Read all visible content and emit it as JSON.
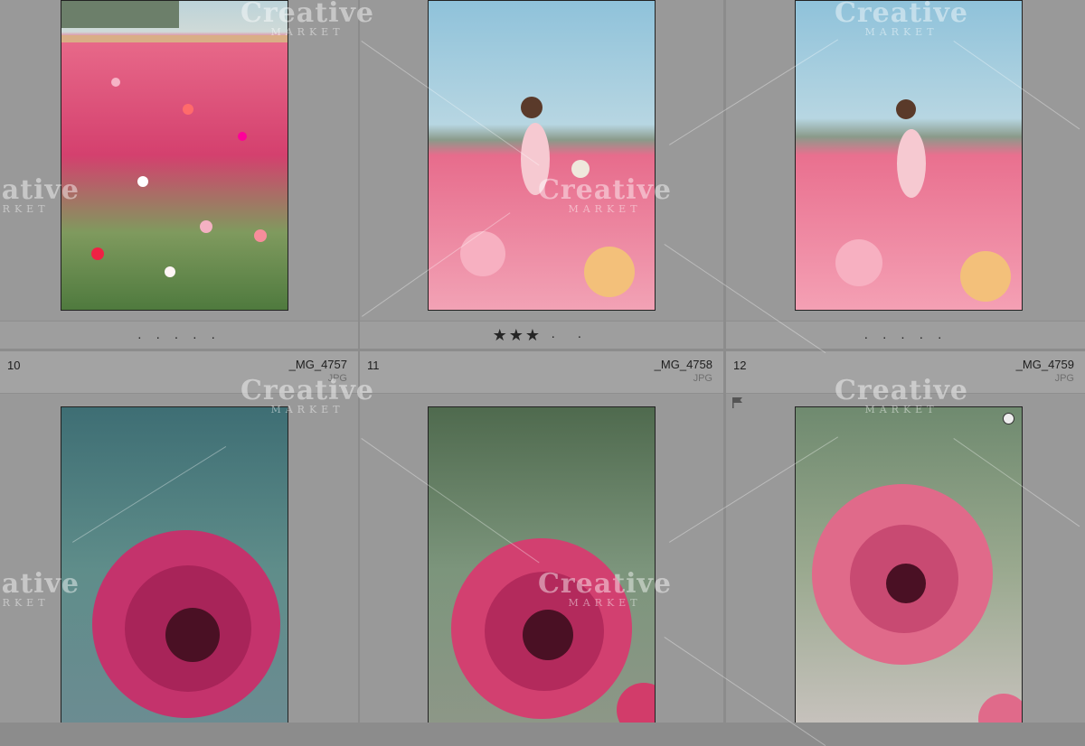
{
  "cells": [
    {
      "index": "",
      "filename": "",
      "ext": "",
      "rating_text": ". . . . ."
    },
    {
      "index": "",
      "filename": "",
      "ext": "",
      "stars": "★★★",
      "rating_dots": "· ·"
    },
    {
      "index": "",
      "filename": "",
      "ext": "",
      "rating_text": ". . . . ."
    },
    {
      "index": "10",
      "filename": "_MG_4757",
      "ext": "JPG"
    },
    {
      "index": "11",
      "filename": "_MG_4758",
      "ext": "JPG"
    },
    {
      "index": "12",
      "filename": "_MG_4759",
      "ext": "JPG"
    }
  ],
  "watermark": {
    "line1": "Creative",
    "line2": "MARKET"
  },
  "icons": {
    "flag": "flag-icon",
    "circle": "circle-badge-icon",
    "star": "star-icon"
  },
  "colors": {
    "panel": "#999999",
    "header": "#a3a3a3",
    "gutter": "#8c8c8c",
    "pink": "#d6406e"
  }
}
